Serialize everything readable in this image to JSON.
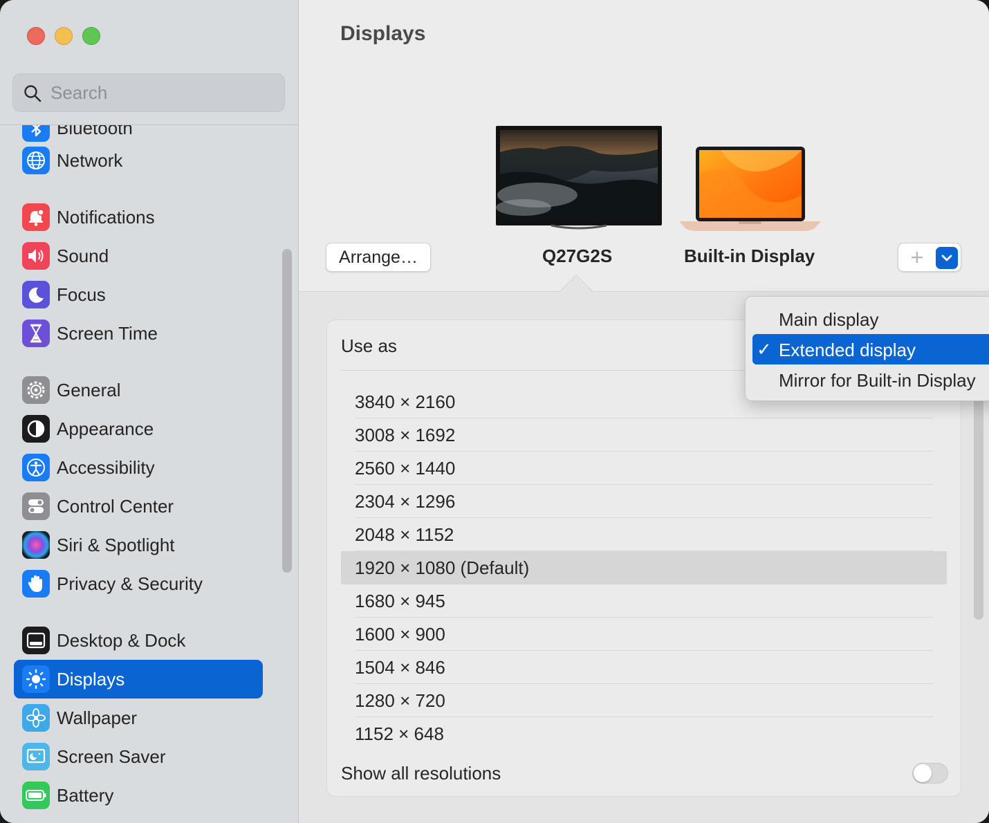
{
  "window": {
    "title": "Displays"
  },
  "search": {
    "placeholder": "Search"
  },
  "sidebar": {
    "items": [
      {
        "label": "Bluetooth",
        "icon": "bluetooth-icon",
        "color": "#1a7cf5"
      },
      {
        "label": "Network",
        "icon": "globe-icon",
        "color": "#1a7cf5"
      },
      {
        "label": "Notifications",
        "icon": "bell-icon",
        "color": "#f2474f"
      },
      {
        "label": "Sound",
        "icon": "speaker-icon",
        "color": "#f0445a"
      },
      {
        "label": "Focus",
        "icon": "moon-icon",
        "color": "#5a52d9"
      },
      {
        "label": "Screen Time",
        "icon": "hourglass-icon",
        "color": "#6e4fd8"
      },
      {
        "label": "General",
        "icon": "gear-icon",
        "color": "#8e8e93"
      },
      {
        "label": "Appearance",
        "icon": "appearance-icon",
        "color": "#1c1c1e"
      },
      {
        "label": "Accessibility",
        "icon": "accessibility-icon",
        "color": "#1a7cf5"
      },
      {
        "label": "Control Center",
        "icon": "toggles-icon",
        "color": "#8e8e93"
      },
      {
        "label": "Siri & Spotlight",
        "icon": "siri-icon",
        "color": "#2a2a3a"
      },
      {
        "label": "Privacy & Security",
        "icon": "hand-icon",
        "color": "#1a7cf5"
      },
      {
        "label": "Desktop & Dock",
        "icon": "dock-icon",
        "color": "#1c1c1e"
      },
      {
        "label": "Displays",
        "icon": "sun-icon",
        "color": "#1a7cf5",
        "active": true
      },
      {
        "label": "Wallpaper",
        "icon": "flower-icon",
        "color": "#3fa8e8"
      },
      {
        "label": "Screen Saver",
        "icon": "screensaver-icon",
        "color": "#4fb6e8"
      },
      {
        "label": "Battery",
        "icon": "battery-icon",
        "color": "#34c759"
      }
    ]
  },
  "main": {
    "title": "Displays",
    "arrange_label": "Arrange…",
    "displays": [
      {
        "name": "Q27G2S",
        "selected": true
      },
      {
        "name": "Built-in Display",
        "selected": false
      }
    ],
    "add_label": "+",
    "use_as_label": "Use as",
    "resolutions": [
      "3840 × 2160",
      "3008 × 1692",
      "2560 × 1440",
      "2304 × 1296",
      "2048 × 1152",
      "1920 × 1080 (Default)",
      "1680 × 945",
      "1600 × 900",
      "1504 × 846",
      "1280 × 720",
      "1152 × 648"
    ],
    "selected_resolution": "1920 × 1080 (Default)",
    "show_all_label": "Show all resolutions",
    "show_all_on": false
  },
  "use_as_menu": {
    "options": [
      "Main display",
      "Extended display",
      "Mirror for Built-in Display"
    ],
    "selected": "Extended display",
    "checkmark": "✓"
  },
  "colors": {
    "accent": "#0a64d2",
    "sidebar_bg": "#d9dcdf",
    "content_bg": "#ececec"
  }
}
